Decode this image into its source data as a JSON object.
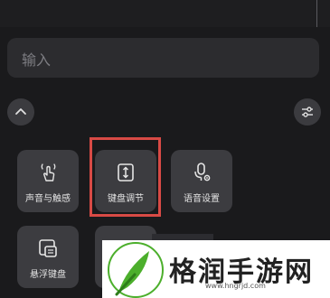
{
  "input": {
    "placeholder": "输入"
  },
  "buttons": {
    "collapse": "chevron-up-icon",
    "settings": "sliders-icon"
  },
  "tiles": [
    {
      "label": "声音与触感",
      "icon": "touch-vibration-icon"
    },
    {
      "label": "键盘调节",
      "icon": "resize-vertical-icon",
      "highlighted": true
    },
    {
      "label": "语音设置",
      "icon": "microphone-settings-icon"
    },
    {
      "label": "悬浮键盘",
      "icon": "floating-keyboard-icon"
    },
    {
      "label": "",
      "icon": ""
    }
  ],
  "watermark": {
    "brand": "格润手游网",
    "url": "www.hngrjd.com"
  },
  "colors": {
    "highlight": "#d84a45",
    "logo_green": "#4caf2c",
    "background": "#1a1a1c"
  }
}
